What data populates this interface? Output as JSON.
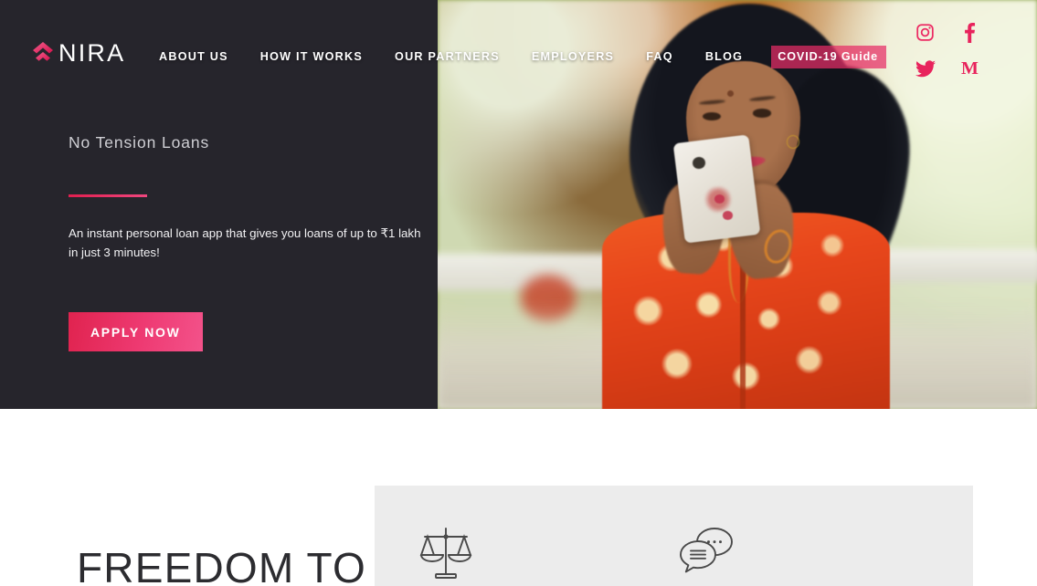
{
  "site": {
    "brand_name": "NIRA",
    "accent_pink": "#e8235c",
    "accent_crimson": "#e0234f",
    "dark_panel": "#26252c",
    "card_grey": "#ececec"
  },
  "header": {
    "logo_text": "NIRA",
    "logo_icon": "nira-chevron-logo",
    "nav": [
      {
        "label": "ABOUT US",
        "name": "nav-about-us"
      },
      {
        "label": "HOW IT WORKS",
        "name": "nav-how-it-works"
      },
      {
        "label": "OUR PARTNERS",
        "name": "nav-our-partners"
      },
      {
        "label": "EMPLOYERS",
        "name": "nav-employers"
      },
      {
        "label": "FAQ",
        "name": "nav-faq"
      },
      {
        "label": "BLOG",
        "name": "nav-blog"
      }
    ],
    "badge": {
      "label": "COVID-19 Guide",
      "background": "rgba(230,45,103,0.72)"
    },
    "social": [
      {
        "name": "instagram-icon",
        "label": "Instagram"
      },
      {
        "name": "facebook-icon",
        "label": "Facebook"
      },
      {
        "name": "twitter-icon",
        "label": "Twitter"
      },
      {
        "name": "medium-icon",
        "label": "M"
      }
    ]
  },
  "hero": {
    "kicker": "No Tension Loans",
    "subtitle": "An instant personal loan app that gives you loans of up to ₹1 lakh in just 3 minutes!",
    "cta_label": "APPLY NOW",
    "image_alt": "Young woman in orange patterned kurta using a smartphone outdoors"
  },
  "below": {
    "heading": "FREEDOM TO BE",
    "features": [
      {
        "icon": "balance-scales-icon",
        "name": "feature-transparency"
      },
      {
        "icon": "speech-bubbles-icon",
        "name": "feature-communication"
      }
    ]
  }
}
